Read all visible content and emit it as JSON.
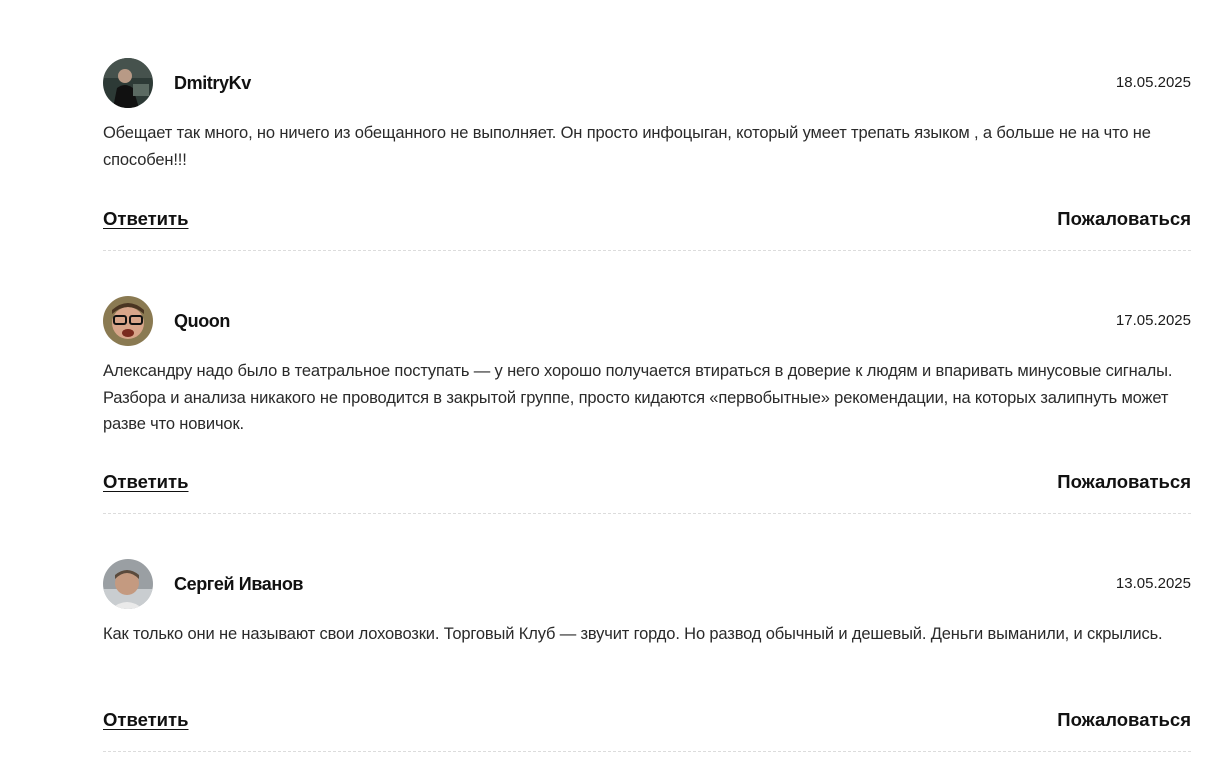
{
  "comments": [
    {
      "author": "DmitryKv",
      "date": "18.05.2025",
      "text": "Обещает так много, но ничего из обещанного не выполняет. Он просто инфоцыган, который умеет трепать языком , а больше не на что не способен!!!",
      "reply_label": "Ответить",
      "report_label": "Пожаловаться"
    },
    {
      "author": "Quoon",
      "date": "17.05.2025",
      "text": "Александру надо было в театральное поступать — у него хорошо получается втираться в доверие к людям и впаривать минусовые сигналы. Разбора и анализа никакого не проводится в закрытой группе, просто кидаются «первобытные» рекомендации, на которых залипнуть может разве что новичок.",
      "reply_label": "Ответить",
      "report_label": "Пожаловаться"
    },
    {
      "author": "Сергей Иванов",
      "date": "13.05.2025",
      "text": "Как только они не называют свои лоховозки. Торговый Клуб — звучит гордо. Но развод обычный и дешевый. Деньги выманили, и скрылись.",
      "reply_label": "Ответить",
      "report_label": "Пожаловаться"
    }
  ]
}
